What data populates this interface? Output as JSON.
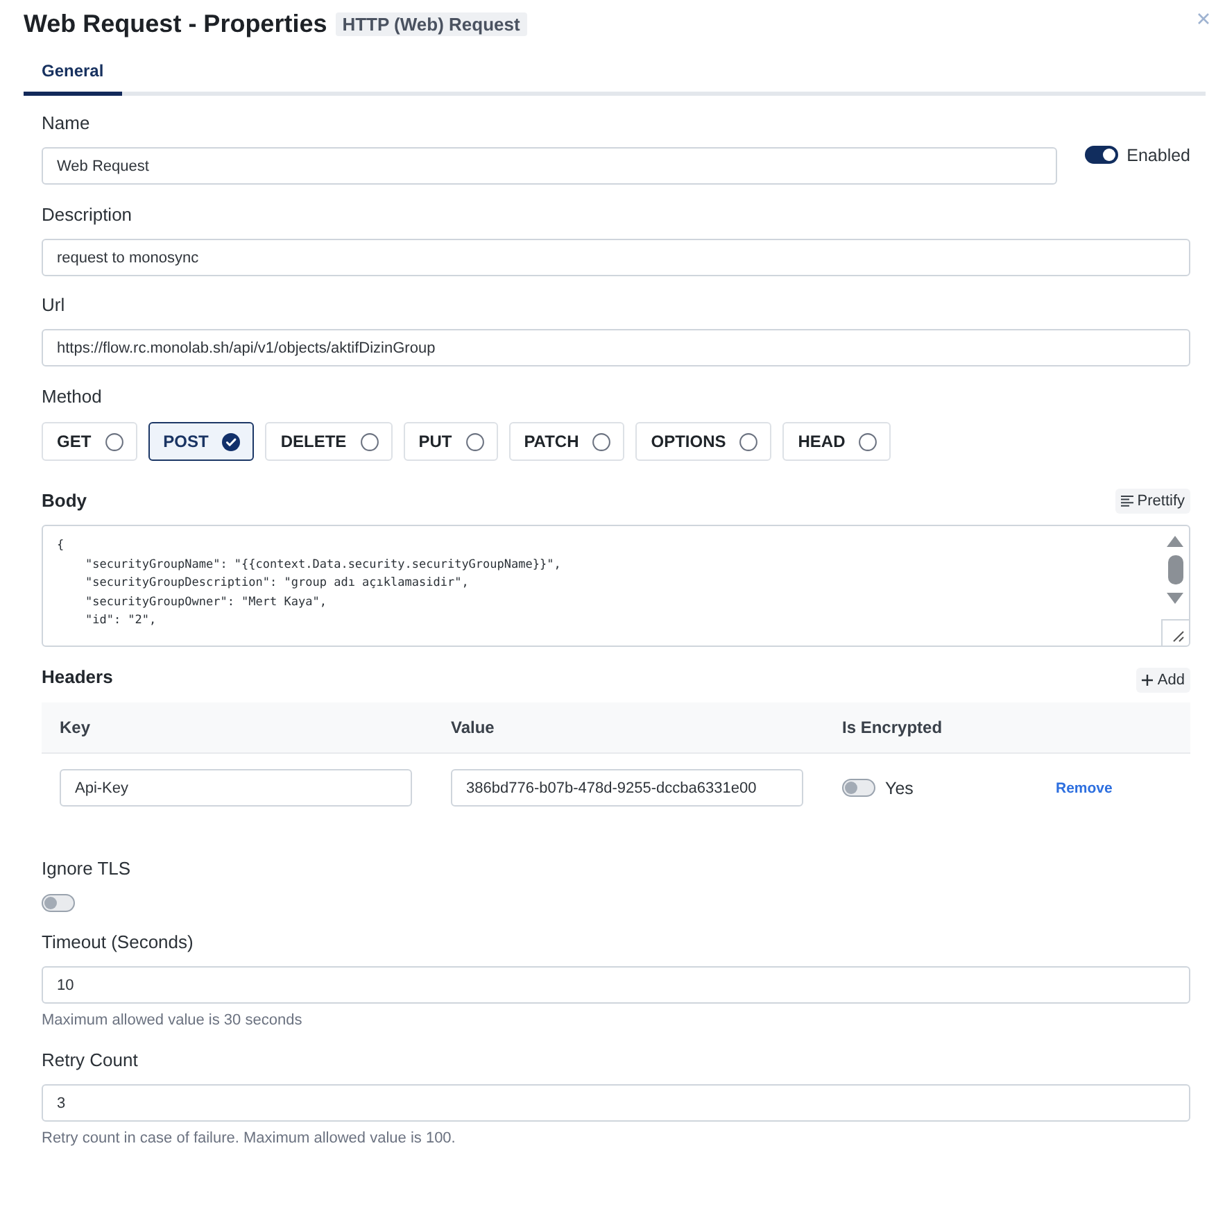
{
  "window": {
    "title": "Web Request - Properties",
    "badge": "HTTP (Web) Request"
  },
  "tabs": [
    {
      "label": "General",
      "selected": true
    }
  ],
  "form": {
    "name": {
      "label": "Name",
      "value": "Web Request"
    },
    "enabled": {
      "label": "Enabled",
      "on": true
    },
    "description": {
      "label": "Description",
      "value": "request to monosync"
    },
    "url": {
      "label": "Url",
      "value": "https://flow.rc.monolab.sh/api/v1/objects/aktifDizinGroup"
    },
    "method": {
      "label": "Method",
      "options": [
        {
          "label": "GET",
          "selected": false
        },
        {
          "label": "POST",
          "selected": true
        },
        {
          "label": "DELETE",
          "selected": false
        },
        {
          "label": "PUT",
          "selected": false
        },
        {
          "label": "PATCH",
          "selected": false
        },
        {
          "label": "OPTIONS",
          "selected": false
        },
        {
          "label": "HEAD",
          "selected": false
        }
      ]
    },
    "body": {
      "label": "Body",
      "prettify_button": "Prettify",
      "lines": [
        "{",
        "    \"securityGroupName\": \"{{context.Data.security.securityGroupName}}\",",
        "    \"securityGroupDescription\": \"group adı açıklamasidir\",",
        "    \"securityGroupOwner\": \"Mert Kaya\",",
        "    \"id\": \"2\","
      ]
    },
    "headers": {
      "label": "Headers",
      "add_button": "Add",
      "columns": [
        "Key",
        "Value",
        "Is Encrypted"
      ],
      "rows": [
        {
          "key": "Api-Key",
          "value": "386bd776-b07b-478d-9255-dccba6331e00",
          "encrypted": false,
          "encrypted_label": "Yes",
          "remove_link": "Remove"
        }
      ]
    },
    "ignore_tls": {
      "label": "Ignore TLS",
      "on": false
    },
    "timeout": {
      "label": "Timeout (Seconds)",
      "value": "10",
      "help": "Maximum allowed value is 30 seconds"
    },
    "retry_count": {
      "label": "Retry Count",
      "value": "3",
      "help": "Retry count in case of failure. Maximum allowed value is 100."
    }
  }
}
